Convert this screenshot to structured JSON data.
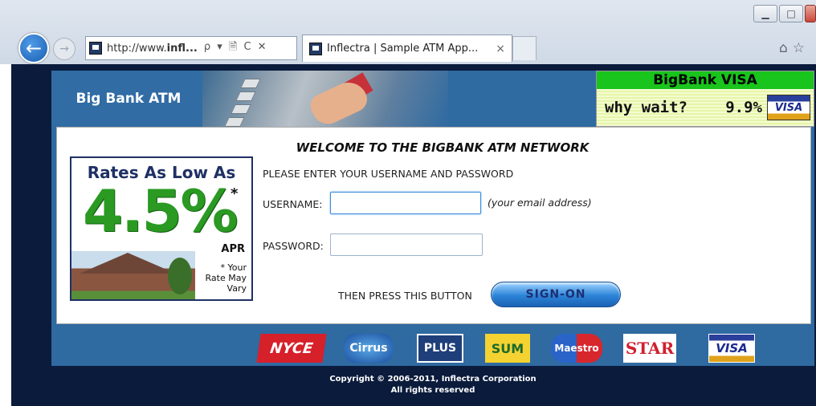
{
  "browser": {
    "url_prefix": "http://www.",
    "url_bold": "infl...",
    "address_controls": "ρ ▾ 🗎 C ✕",
    "tab_title": "Inflectra | Sample ATM App...",
    "tab_close": "×",
    "back_icon": "arrow-left",
    "forward_icon": "arrow-right"
  },
  "header": {
    "title": "Big Bank ATM",
    "visa_ad": {
      "title": "BigBank VISA",
      "tagline": "why wait?",
      "rate": "9.9%",
      "card_label": "VISA"
    }
  },
  "promo": {
    "headline": "Rates As Low As",
    "rate": "4.5%",
    "asterisk": "*",
    "apr": "APR",
    "note": "* Your Rate May Vary"
  },
  "login": {
    "welcome": "WELCOME TO THE BIGBANK ATM NETWORK",
    "instruction": "PLEASE ENTER YOUR USERNAME AND PASSWORD",
    "username_label": "USERNAME:",
    "username_value": "",
    "username_hint": "(your email address)",
    "password_label": "PASSWORD:",
    "password_value": "",
    "then_label": "THEN PRESS THIS BUTTON",
    "signon_label": "SIGN-ON"
  },
  "networks": [
    "NYCE",
    "Cirrus",
    "PLUS",
    "SUM",
    "Maestro",
    "STAR",
    "VISA"
  ],
  "footer": {
    "line1": "Copyright © 2006-2011, Inflectra Corporation",
    "line2": "All rights reserved"
  }
}
